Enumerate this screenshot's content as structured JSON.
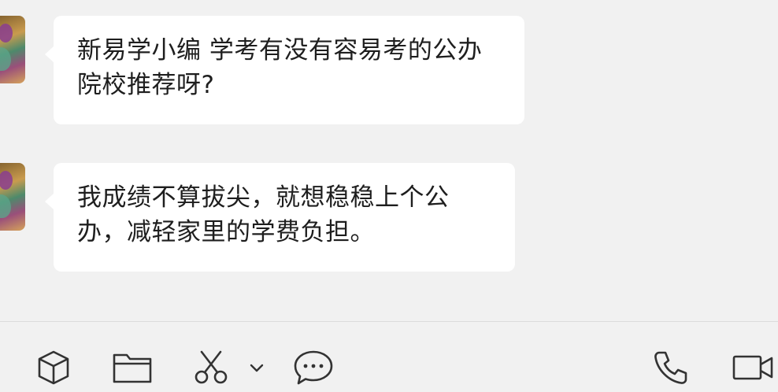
{
  "messages": [
    {
      "text": "新易学小编 学考有没有容易考的公办院校推荐呀?"
    },
    {
      "text": "我成绩不算拔尖，就想稳稳上个公办，减轻家里的学费负担。"
    }
  ],
  "toolbar": {
    "left_tools": [
      "cube-icon",
      "folder-icon",
      "scissors-icon",
      "chevron-down-icon",
      "chat-bubble-icon"
    ],
    "right_tools": [
      "phone-icon",
      "video-camera-icon"
    ]
  },
  "colors": {
    "background": "#f1f1f1",
    "bubble": "#ffffff",
    "text": "#1e1e1e",
    "icon": "#333333"
  }
}
